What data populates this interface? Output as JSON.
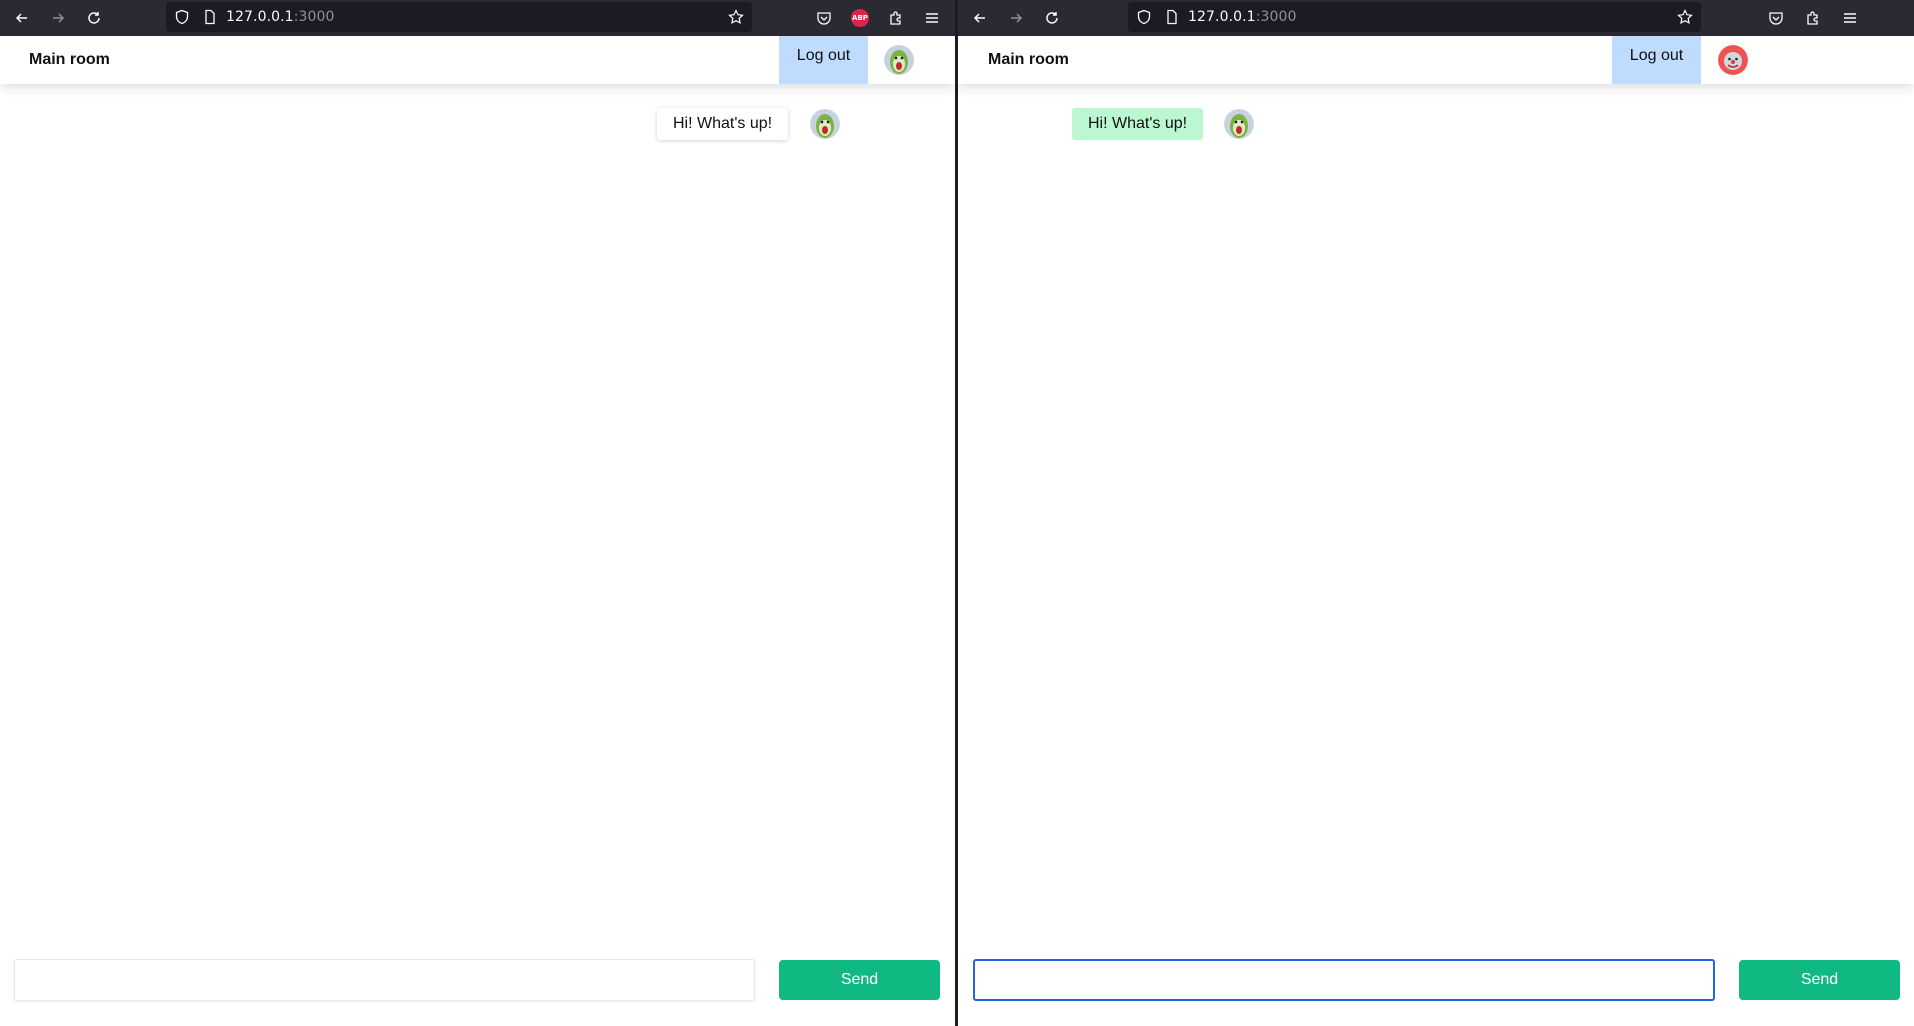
{
  "left": {
    "url_host": "127.0.0.1",
    "url_port": ":3000",
    "room_title": "Main room",
    "logout_label": "Log out",
    "message_text": "Hi! What's up!",
    "composer_value": "",
    "send_label": "Send",
    "abp_label": "ABP"
  },
  "right": {
    "url_host": "127.0.0.1",
    "url_port": ":3000",
    "room_title": "Main room",
    "logout_label": "Log out",
    "message_text": "Hi! What's up!",
    "composer_value": "",
    "send_label": "Send"
  },
  "icons": {
    "back": "back-arrow-icon",
    "forward": "forward-arrow-icon",
    "reload": "reload-icon",
    "shield": "shield-icon",
    "page": "page-icon",
    "bookmark": "star-icon",
    "pocket": "pocket-icon",
    "extensions": "puzzle-icon",
    "menu": "hamburger-menu-icon"
  },
  "colors": {
    "logout_bg": "#bfdbfe",
    "send_bg": "#10b981",
    "own_message_bg": "#bbf7d0",
    "focus_border": "#2563eb",
    "toolbar_bg": "#2b2a33"
  }
}
